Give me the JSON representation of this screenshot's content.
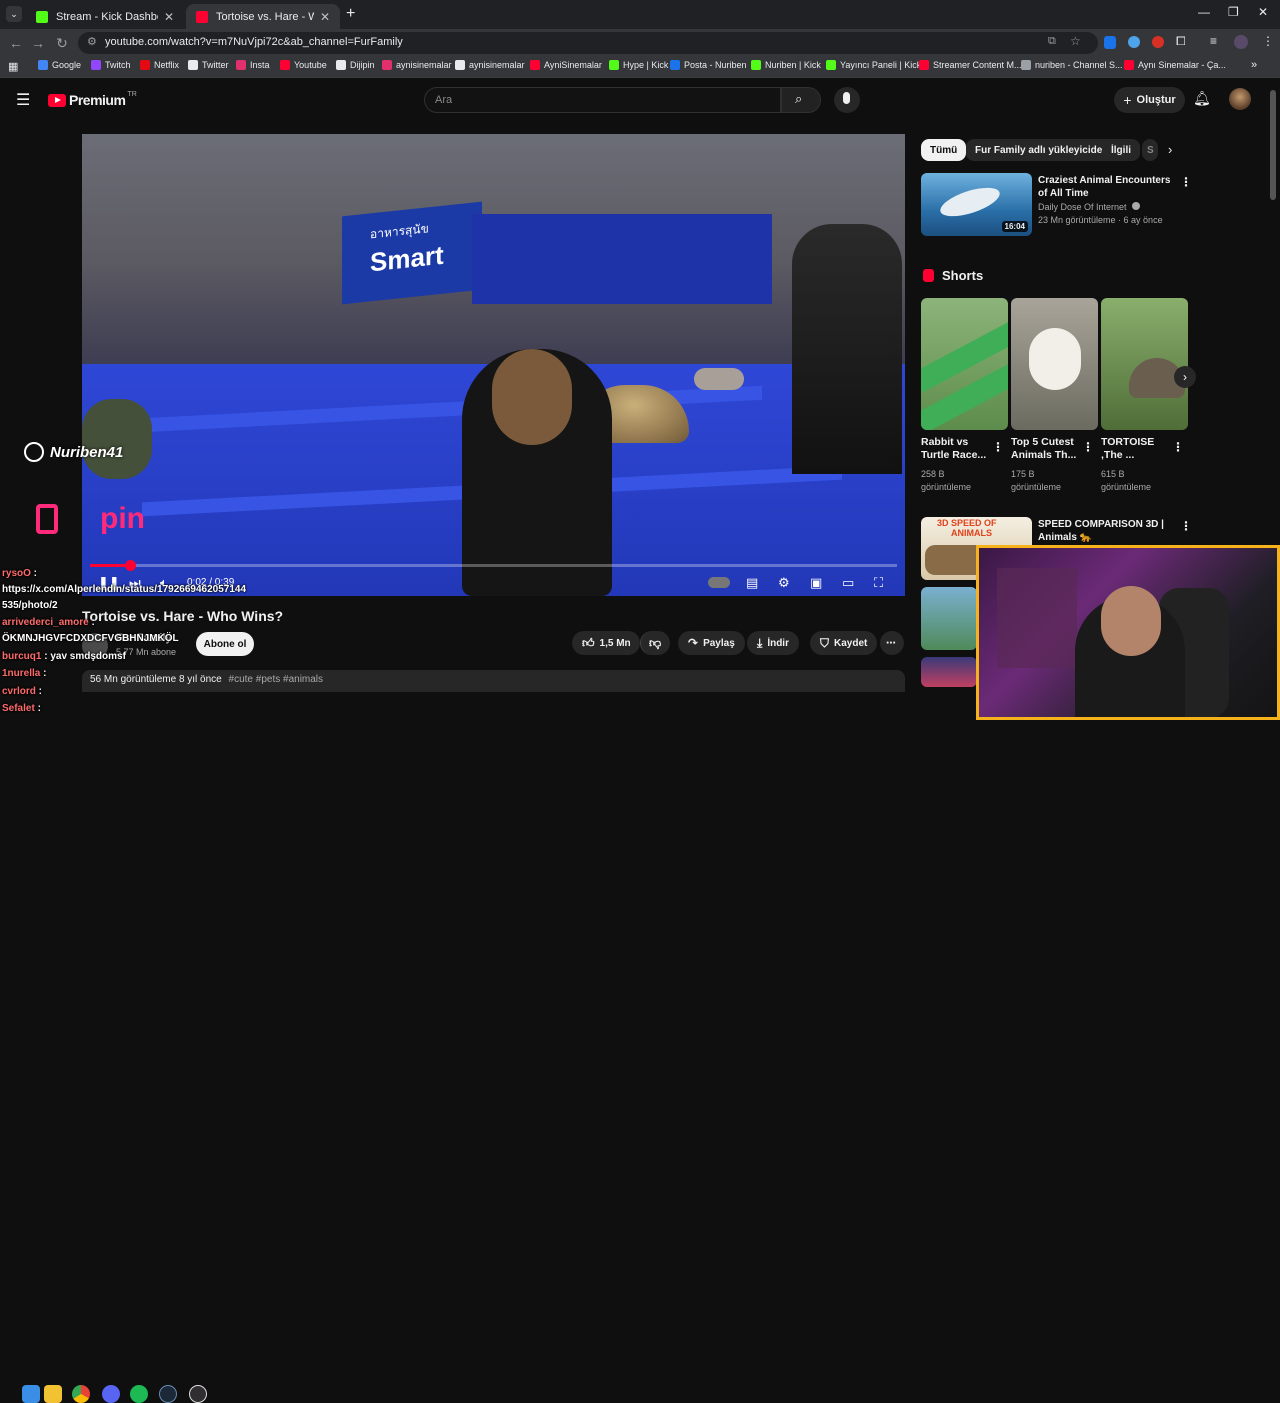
{
  "browser": {
    "tabs": [
      {
        "label": "Stream - Kick Dashboard",
        "color": "#53fc18"
      },
      {
        "label": "Tortoise vs. Hare - Who Wins?",
        "color": "#ff0033"
      }
    ],
    "url": "youtube.com/watch?v=m7NuVjpi72c&ab_channel=FurFamily",
    "bookmarks": [
      {
        "label": "Google",
        "color": "#4285f4"
      },
      {
        "label": "Twitch",
        "color": "#9146ff"
      },
      {
        "label": "Netflix",
        "color": "#e50914"
      },
      {
        "label": "Twitter",
        "color": "#e8eaed"
      },
      {
        "label": "Insta",
        "color": "#e1306c"
      },
      {
        "label": "Youtube",
        "color": "#ff0033"
      },
      {
        "label": "Dijipin",
        "color": "#e8eaed"
      },
      {
        "label": "aynisinemalar",
        "color": "#e1306c"
      },
      {
        "label": "aynisinemalar",
        "color": "#e8eaed"
      },
      {
        "label": "AyniSinemalar",
        "color": "#ff0033"
      },
      {
        "label": "Hype | Kick",
        "color": "#53fc18"
      },
      {
        "label": "Posta - Nuriben",
        "color": "#1a73e8"
      },
      {
        "label": "Nuriben | Kick",
        "color": "#53fc18"
      },
      {
        "label": "Yayıncı Paneli | Kick",
        "color": "#53fc18"
      },
      {
        "label": "Streamer Content M...",
        "color": "#ff0033"
      },
      {
        "label": "nuriben - Channel S...",
        "color": "#9aa0a6"
      },
      {
        "label": "Aynı Sinemalar - Ça...",
        "color": "#ff0033"
      }
    ]
  },
  "header": {
    "logo": "Premium",
    "logo_sup": "TR",
    "search_placeholder": "Ara",
    "login": "Oluştur"
  },
  "player": {
    "banner_text": "Smart",
    "banner_top": "อาหารสุนัข",
    "time": "0:02 / 0:39",
    "progress_fraction": 0.05,
    "watermark_name": "Nuriben41",
    "watermark_brand": "pin"
  },
  "video": {
    "title": "Tortoise vs. Hare - Who Wins?",
    "channel": "Fur Family",
    "subs": "5,77 Mn abone",
    "subscribe": "Abone ol",
    "likes": "1,5 Mn",
    "share": "Paylaş",
    "download": "İndir",
    "save": "Kaydet",
    "views_date": "56 Mn görüntüleme  8 yıl önce",
    "tags": "#cute #pets #animals"
  },
  "sidebar": {
    "chips": [
      "Tümü",
      "Fur Family adlı yükleyiciden",
      "İlgili",
      "S"
    ],
    "rec1": {
      "title": "Craziest Animal Encounters of All Time",
      "channel": "Daily Dose Of Internet",
      "meta": "23 Mn görüntüleme · 6 ay önce",
      "duration": "16:04"
    },
    "shorts_heading": "Shorts",
    "shorts": [
      {
        "title": "Rabbit vs Turtle Race...",
        "views": "258 B",
        "unit": "görüntüleme"
      },
      {
        "title": "Top 5 Cutest Animals Th...",
        "views": "175 B",
        "unit": "görüntüleme"
      },
      {
        "title": "TORTOISE ,The ...",
        "views": "615 B",
        "unit": "görüntüleme"
      }
    ],
    "rec2": {
      "title": "SPEED COMPARISON 3D | Animals 🐆",
      "thumb_text1": "3D SPEED OF",
      "thumb_text2": "ANIMALS"
    }
  },
  "chat": [
    {
      "user": "rysoO",
      "text": ""
    },
    {
      "user": "",
      "text": "https://x.com/Alperlendin/status/1792669462057144"
    },
    {
      "user": "",
      "text": "535/photo/2"
    },
    {
      "user": "arrivederci_amore",
      "text": ""
    },
    {
      "user": "",
      "text": "ÖKMNJHGVFCDXDCFVGBHNJMKÖL"
    },
    {
      "user": "burcuq1",
      "text": "yav smdşdomsf"
    },
    {
      "user": "1nurella",
      "text": ""
    },
    {
      "user": "cvrlord",
      "text": ""
    },
    {
      "user": "Sefalet",
      "text": ""
    }
  ]
}
